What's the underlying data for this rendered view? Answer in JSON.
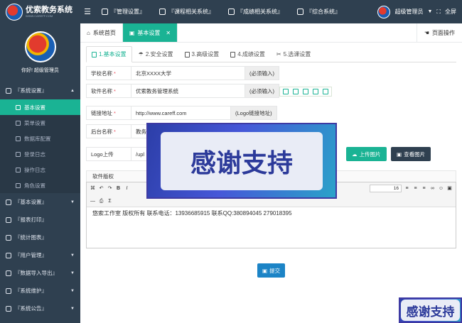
{
  "app": {
    "name": "优索教务系统",
    "sub": "WWW.CAREFF.COM"
  },
  "topnav": [
    {
      "label": "『管理设置』"
    },
    {
      "label": "『课程相关系统』"
    },
    {
      "label": "『成绩相关系统』"
    },
    {
      "label": "『综合系统』"
    }
  ],
  "user": {
    "name": "超级管理员",
    "fullscreen": "全屏",
    "hello": "你好! 超级管理员"
  },
  "sidebar": {
    "groups": [
      {
        "label": "『系统设置』",
        "expanded": true
      },
      {
        "label": "『基本设置』"
      },
      {
        "label": "『报表打印』"
      },
      {
        "label": "『统计图表』"
      },
      {
        "label": "『用户管理』"
      },
      {
        "label": "『数据导入导出』"
      },
      {
        "label": "『系统维护』"
      },
      {
        "label": "『系统公告』"
      }
    ],
    "subitems": [
      {
        "label": "基本设置",
        "active": true
      },
      {
        "label": "菜单设置"
      },
      {
        "label": "数据库配置"
      },
      {
        "label": "登录日志"
      },
      {
        "label": "操作日志"
      },
      {
        "label": "角色设置"
      }
    ]
  },
  "tabs": [
    {
      "label": "系统首页"
    },
    {
      "label": "基本设置",
      "active": true
    }
  ],
  "page_ops": "页面操作",
  "steps": [
    {
      "label": "1.基本设置",
      "active": true
    },
    {
      "label": "2.安全设置"
    },
    {
      "label": "3.高级设置"
    },
    {
      "label": "4.成绩设置"
    },
    {
      "label": "5.选课设置"
    }
  ],
  "form": {
    "school_label": "学校名称",
    "school_value": "北京XXXX大学",
    "school_hint": "(必须输入)",
    "software_label": "软件名称",
    "software_value": "优索教务管理系统",
    "software_hint": "(必须输入)",
    "link_label": "链接地址",
    "link_value": "http://www.careff.com",
    "link_hint": "(Logo链接地址)",
    "admin_label": "后台名称",
    "admin_value": "教务",
    "logo_label": "Logo上传",
    "logo_value": "/upl",
    "upload_btn": "上传图片",
    "view_btn": "查看图片",
    "copyright_label": "软件版权",
    "copyright_text": "悠索工作室 版权所有 联系电话：13936685915 联系QQ:380894045 279018395",
    "font_size": "16",
    "submit": "提交"
  },
  "banner": {
    "text": "感谢支持"
  },
  "colors": {
    "sidebar": "#2f4050",
    "accent": "#1ab394",
    "primary": "#1c84c6"
  }
}
